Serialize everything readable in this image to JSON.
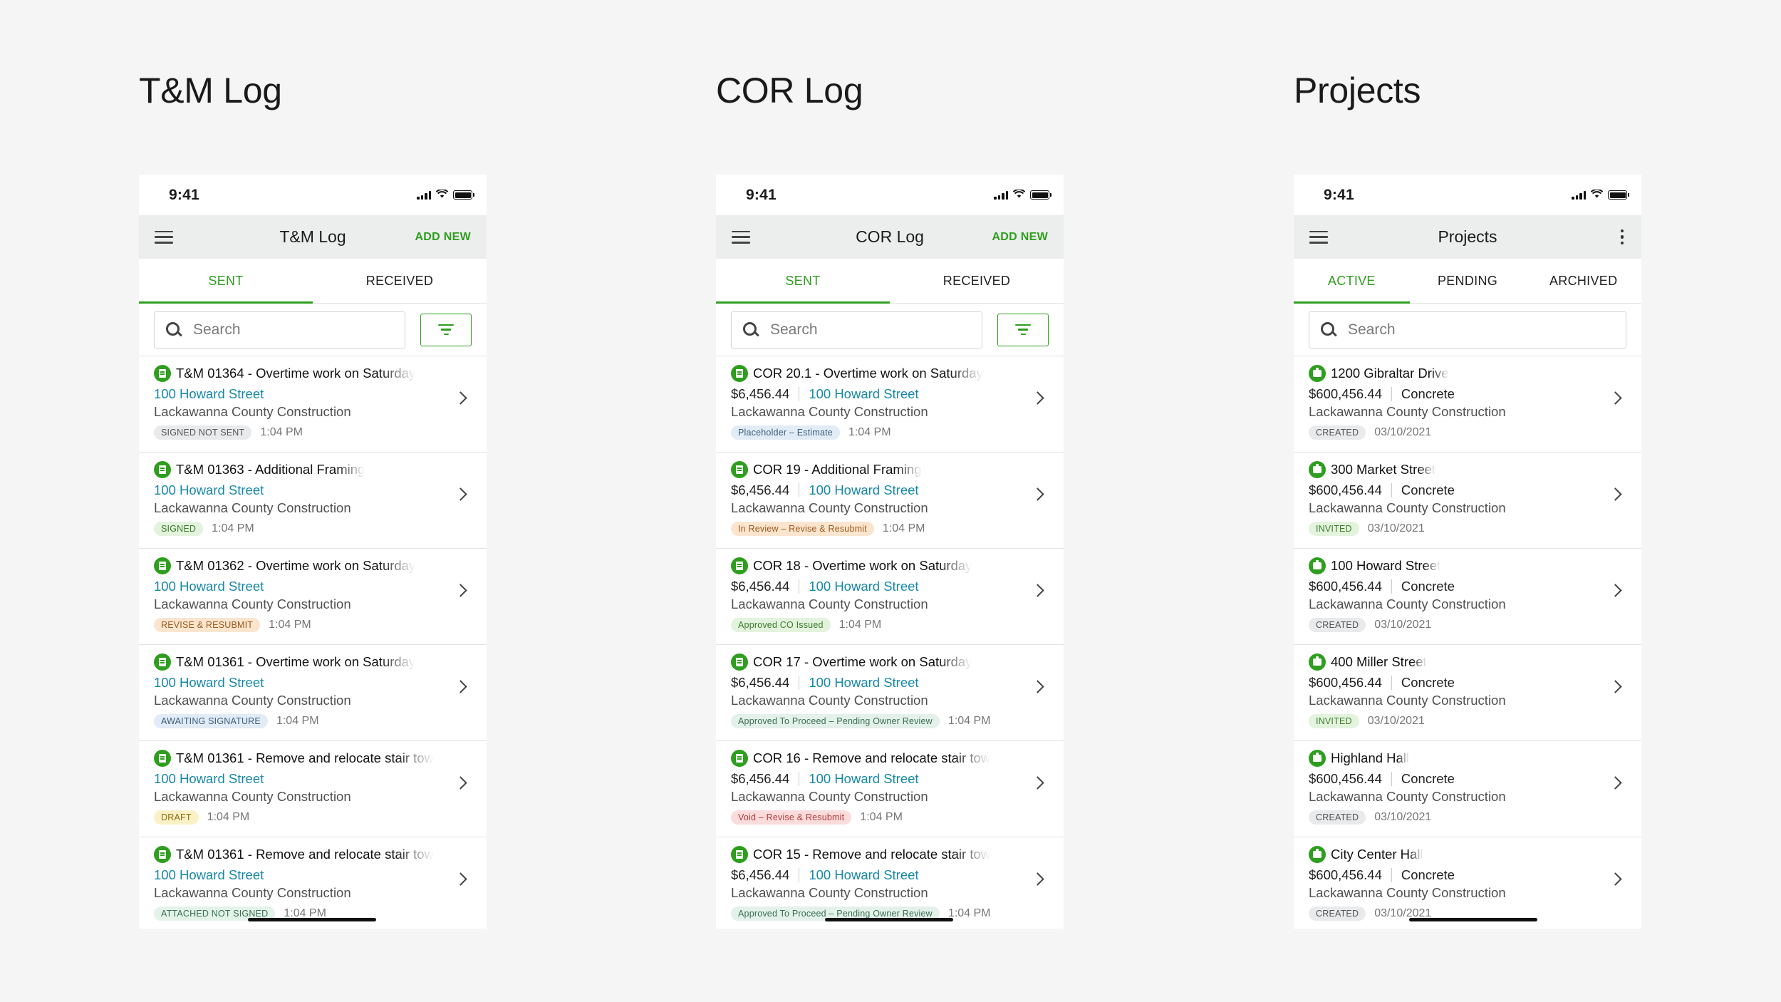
{
  "screens": [
    {
      "heading": "T&M Log",
      "status_time": "9:41",
      "appbar_title": "T&M Log",
      "appbar_action": "ADD NEW",
      "tabs": [
        "SENT",
        "RECEIVED"
      ],
      "active_tab": "SENT",
      "search_placeholder": "Search",
      "items": [
        {
          "title": "T&M 01364 - Overtime work on Saturday",
          "link": "100 Howard Street",
          "company": "Lackawanna County Construction",
          "badge": "SIGNED NOT SENT",
          "time": "1:04 PM"
        },
        {
          "title": "T&M 01363 - Additional Framing",
          "link": "100 Howard Street",
          "company": "Lackawanna County Construction",
          "badge": "SIGNED",
          "time": "1:04 PM"
        },
        {
          "title": "T&M 01362 - Overtime work on Saturday",
          "link": "100 Howard Street",
          "company": "Lackawanna County Construction",
          "badge": "REVISE & RESUBMIT",
          "time": "1:04 PM"
        },
        {
          "title": "T&M 01361 - Overtime work on Saturday",
          "link": "100 Howard Street",
          "company": "Lackawanna County Construction",
          "badge": "AWAITING SIGNATURE",
          "time": "1:04 PM"
        },
        {
          "title": "T&M 01361 - Remove and relocate stair tow",
          "link": "100 Howard Street",
          "company": "Lackawanna County Construction",
          "badge": "DRAFT",
          "time": "1:04 PM"
        },
        {
          "title": "T&M 01361 - Remove and relocate stair tow",
          "link": "100 Howard Street",
          "company": "Lackawanna County Construction",
          "badge": "ATTACHED NOT SIGNED",
          "time": "1:04 PM"
        }
      ]
    },
    {
      "heading": "COR Log",
      "status_time": "9:41",
      "appbar_title": "COR Log",
      "appbar_action": "ADD NEW",
      "tabs": [
        "SENT",
        "RECEIVED"
      ],
      "active_tab": "SENT",
      "search_placeholder": "Search",
      "items": [
        {
          "title": "COR 20.1 - Overtime work on Saturday",
          "amount": "$6,456.44",
          "link": "100 Howard Street",
          "company": "Lackawanna County Construction",
          "badge": "Placeholder – Estimate",
          "time": "1:04 PM"
        },
        {
          "title": "COR 19 - Additional Framing",
          "amount": "$6,456.44",
          "link": "100 Howard Street",
          "company": "Lackawanna County Construction",
          "badge": "In Review – Revise & Resubmit",
          "time": "1:04 PM"
        },
        {
          "title": "COR 18 - Overtime work on Saturday",
          "amount": "$6,456.44",
          "link": "100 Howard Street",
          "company": "Lackawanna County Construction",
          "badge": "Approved CO Issued",
          "time": "1:04 PM"
        },
        {
          "title": "COR 17 - Overtime work on Saturday",
          "amount": "$6,456.44",
          "link": "100 Howard Street",
          "company": "Lackawanna County Construction",
          "badge": "Approved To Proceed – Pending Owner Review",
          "time": "1:04 PM"
        },
        {
          "title": "COR 16 - Remove and relocate stair tow",
          "amount": "$6,456.44",
          "link": "100 Howard Street",
          "company": "Lackawanna County Construction",
          "badge": "Void – Revise & Resubmit",
          "time": "1:04 PM"
        },
        {
          "title": "COR 15 - Remove and relocate stair tow",
          "amount": "$6,456.44",
          "link": "100 Howard Street",
          "company": "Lackawanna County Construction",
          "badge": "Approved To Proceed – Pending Owner Review",
          "time": "1:04 PM"
        }
      ]
    },
    {
      "heading": "Projects",
      "status_time": "9:41",
      "appbar_title": "Projects",
      "tabs": [
        "ACTIVE",
        "PENDING",
        "ARCHIVED"
      ],
      "active_tab": "ACTIVE",
      "search_placeholder": "Search",
      "items": [
        {
          "title": "1200 Gibraltar Drive",
          "amount": "$600,456.44",
          "trade": "Concrete",
          "company": "Lackawanna County Construction",
          "badge": "CREATED",
          "time": "03/10/2021"
        },
        {
          "title": "300 Market Street",
          "amount": "$600,456.44",
          "trade": "Concrete",
          "company": "Lackawanna County Construction",
          "badge": "INVITED",
          "time": "03/10/2021"
        },
        {
          "title": "100 Howard Street",
          "amount": "$600,456.44",
          "trade": "Concrete",
          "company": "Lackawanna County Construction",
          "badge": "CREATED",
          "time": "03/10/2021"
        },
        {
          "title": "400 Miller Street",
          "amount": "$600,456.44",
          "trade": "Concrete",
          "company": "Lackawanna County Construction",
          "badge": "INVITED",
          "time": "03/10/2021"
        },
        {
          "title": "Highland Hall",
          "amount": "$600,456.44",
          "trade": "Concrete",
          "company": "Lackawanna County Construction",
          "badge": "CREATED",
          "time": "03/10/2021"
        },
        {
          "title": "City Center Hall",
          "amount": "$600,456.44",
          "trade": "Concrete",
          "company": "Lackawanna County Construction",
          "badge": "CREATED",
          "time": "03/10/2021"
        }
      ]
    }
  ],
  "badge_colors": {
    "SIGNED NOT SENT": {
      "bg": "#e8eaec",
      "fg": "#555555"
    },
    "SIGNED": {
      "bg": "#e3f3dd",
      "fg": "#3a7d2a"
    },
    "REVISE & RESUBMIT": {
      "bg": "#fbe5cf",
      "fg": "#9c5a1a"
    },
    "AWAITING SIGNATURE": {
      "bg": "#e1ecf6",
      "fg": "#3d5d7c"
    },
    "DRAFT": {
      "bg": "#fbf1c6",
      "fg": "#8a6d0e"
    },
    "ATTACHED NOT SIGNED": {
      "bg": "#e3f3ea",
      "fg": "#3b6e52"
    },
    "Placeholder – Estimate": {
      "bg": "#e1ecf6",
      "fg": "#3d5d7c"
    },
    "In Review – Revise & Resubmit": {
      "bg": "#fbe5cf",
      "fg": "#9c5a1a"
    },
    "Approved CO Issued": {
      "bg": "#e3f3dd",
      "fg": "#3a7d2a"
    },
    "Approved To Proceed – Pending Owner Review": {
      "bg": "#e3f1ea",
      "fg": "#3b6e52"
    },
    "Void – Revise & Resubmit": {
      "bg": "#fbdcdc",
      "fg": "#b23a3a"
    },
    "CREATED": {
      "bg": "#e8eaec",
      "fg": "#555555"
    },
    "INVITED": {
      "bg": "#e3f3dd",
      "fg": "#3a7d2a"
    }
  },
  "colors": {
    "accent": "#2e9e1e",
    "link": "#1688a8"
  },
  "icons": {
    "list_item": "document-icon",
    "project_item": "briefcase-icon",
    "menu": "hamburger-icon",
    "search": "search-icon",
    "filter": "filter-icon",
    "chevron": "chevron-right-icon",
    "overflow": "kebab-menu-icon"
  }
}
